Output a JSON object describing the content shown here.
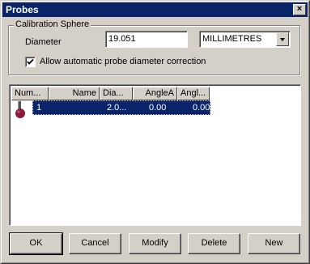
{
  "window": {
    "title": "Probes",
    "close_glyph": "×"
  },
  "calibration": {
    "group_label": "Calibration Sphere",
    "diameter_label": "Diameter",
    "diameter_value": "19.051",
    "units_selected": "MILLIMETRES",
    "auto_correct_label": "Allow automatic probe diameter correction",
    "auto_correct_checked": true
  },
  "table": {
    "columns": [
      "Num...",
      "Name",
      "Dia...",
      "AngleA",
      "Angl..."
    ],
    "rows": [
      {
        "num": "1",
        "name": "",
        "dia": "2.0...",
        "angle_a": "0.00",
        "angle_b": "0.00",
        "icon": "probe-icon",
        "selected": true
      }
    ]
  },
  "buttons": {
    "ok": "OK",
    "cancel": "Cancel",
    "modify": "Modify",
    "delete": "Delete",
    "new": "New"
  },
  "colors": {
    "titlebar": "#0a246a",
    "face": "#d4d0c8",
    "selection": "#0a246a",
    "probe_ball": "#8b1a3c"
  }
}
